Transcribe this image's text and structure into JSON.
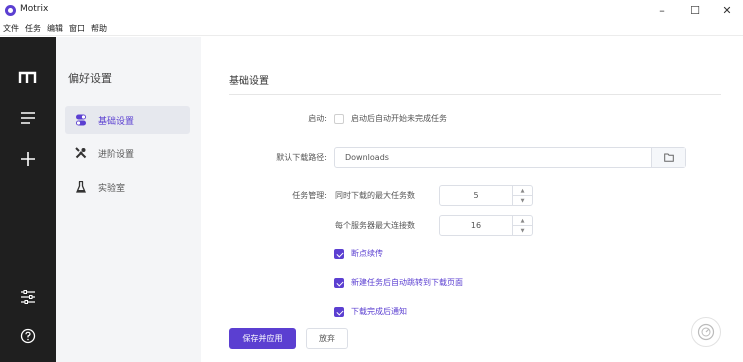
{
  "window": {
    "title": "Motrix",
    "controls": {
      "minimize": "–",
      "maximize": "☐",
      "close": "✕"
    }
  },
  "menubar": {
    "items": [
      "文件",
      "任务",
      "编辑",
      "窗口",
      "帮助"
    ]
  },
  "leftbar": {
    "icons": [
      "motrix-logo-icon",
      "task-list-icon",
      "add-task-icon",
      "preferences-icon",
      "help-icon"
    ]
  },
  "subnav": {
    "title": "偏好设置",
    "items": [
      {
        "label": "基础设置",
        "icon": "toggle-icon",
        "active": true
      },
      {
        "label": "进阶设置",
        "icon": "tools-icon",
        "active": false
      },
      {
        "label": "实验室",
        "icon": "flask-icon",
        "active": false
      }
    ]
  },
  "main": {
    "section_title": "基础设置",
    "startup": {
      "label": "启动:",
      "checkbox_text": "启动后自动开始未完成任务",
      "checked": false
    },
    "download_path": {
      "label": "默认下载路径:",
      "value": "Downloads"
    },
    "task_management": {
      "label": "任务管理:",
      "max_tasks_label": "同时下载的最大任务数",
      "max_tasks_value": "5",
      "max_conn_label": "每个服务器最大连接数",
      "max_conn_value": "16",
      "options": [
        {
          "text": "断点续传",
          "checked": true
        },
        {
          "text": "新建任务后自动跳转到下载页面",
          "checked": true
        },
        {
          "text": "下载完成后通知",
          "checked": true
        }
      ]
    },
    "buttons": {
      "save": "保存并应用",
      "discard": "放弃"
    }
  },
  "colors": {
    "accent": "#5b3fd1",
    "sidebar_bg": "#1f1f1f",
    "subnav_bg": "#f4f5f7"
  }
}
